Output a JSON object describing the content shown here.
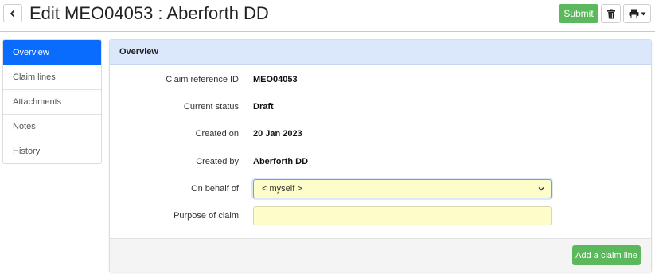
{
  "header": {
    "title": "Edit MEO04053 : Aberforth DD",
    "submit_label": "Submit"
  },
  "sidebar": {
    "items": [
      {
        "label": "Overview",
        "active": true
      },
      {
        "label": "Claim lines"
      },
      {
        "label": "Attachments"
      },
      {
        "label": "Notes"
      },
      {
        "label": "History"
      }
    ]
  },
  "panel": {
    "title": "Overview",
    "fields": {
      "claim_reference": {
        "label": "Claim reference ID",
        "value": "MEO04053"
      },
      "current_status": {
        "label": "Current status",
        "value": "Draft"
      },
      "created_on": {
        "label": "Created on",
        "value": "20 Jan 2023"
      },
      "created_by": {
        "label": "Created by",
        "value": "Aberforth DD"
      },
      "on_behalf_of": {
        "label": "On behalf of",
        "selected": "< myself >"
      },
      "purpose": {
        "label": "Purpose of claim",
        "value": ""
      }
    },
    "add_line_label": "Add a claim line"
  },
  "colors": {
    "accent_blue": "#0a6cff",
    "success_green": "#5cb85c",
    "panel_header": "#dbe8fb",
    "input_yellow": "#fdfdc9"
  }
}
